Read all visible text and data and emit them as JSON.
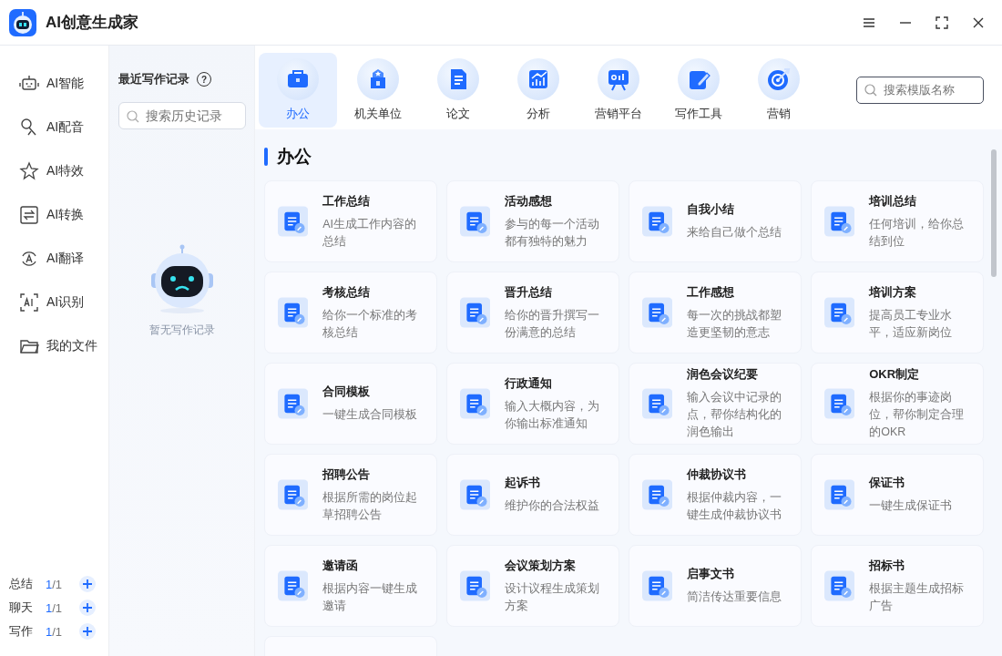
{
  "window": {
    "title": "AI创意生成家"
  },
  "nav": {
    "items": [
      {
        "label": "AI智能",
        "selected": false
      },
      {
        "label": "AI配音",
        "selected": false
      },
      {
        "label": "AI特效",
        "selected": false
      },
      {
        "label": "AI转换",
        "selected": false
      },
      {
        "label": "AI翻译",
        "selected": false
      },
      {
        "label": "AI识别",
        "selected": false
      },
      {
        "label": "我的文件",
        "selected": false
      }
    ],
    "quotas": [
      {
        "label": "总结",
        "used": "1",
        "total": "/1"
      },
      {
        "label": "聊天",
        "used": "1",
        "total": "/1"
      },
      {
        "label": "写作",
        "used": "1",
        "total": "/1"
      }
    ]
  },
  "history": {
    "title": "最近写作记录",
    "help": "?",
    "search": {
      "placeholder": "搜索历史记录"
    },
    "empty_text": "暂无写作记录"
  },
  "tabs": [
    {
      "label": "办公",
      "selected": true
    },
    {
      "label": "机关单位",
      "selected": false
    },
    {
      "label": "论文",
      "selected": false
    },
    {
      "label": "分析",
      "selected": false
    },
    {
      "label": "营销平台",
      "selected": false
    },
    {
      "label": "写作工具",
      "selected": false
    },
    {
      "label": "营销",
      "selected": false
    }
  ],
  "template_search": {
    "placeholder": "搜索模版名称"
  },
  "section": {
    "title": "办公"
  },
  "templates": [
    {
      "title": "工作总结",
      "description": "AI生成工作内容的总结"
    },
    {
      "title": "活动感想",
      "description": "参与的每一个活动都有独特的魅力"
    },
    {
      "title": "自我小结",
      "description": "来给自己做个总结"
    },
    {
      "title": "培训总结",
      "description": "任何培训，给你总结到位"
    },
    {
      "title": "考核总结",
      "description": "给你一个标准的考核总结"
    },
    {
      "title": "晋升总结",
      "description": "给你的晋升撰写一份满意的总结"
    },
    {
      "title": "工作感想",
      "description": "每一次的挑战都塑造更坚韧的意志"
    },
    {
      "title": "培训方案",
      "description": "提高员工专业水平，适应新岗位"
    },
    {
      "title": "合同模板",
      "description": "一键生成合同模板"
    },
    {
      "title": "行政通知",
      "description": "输入大概内容，为你输出标准通知"
    },
    {
      "title": "润色会议纪要",
      "description": "输入会议中记录的点，帮你结构化的润色输出"
    },
    {
      "title": "OKR制定",
      "description": "根据你的事迹岗位，帮你制定合理的OKR"
    },
    {
      "title": "招聘公告",
      "description": "根据所需的岗位起草招聘公告"
    },
    {
      "title": "起诉书",
      "description": "维护你的合法权益"
    },
    {
      "title": "仲裁协议书",
      "description": "根据仲裁内容，一键生成仲裁协议书"
    },
    {
      "title": "保证书",
      "description": "一键生成保证书"
    },
    {
      "title": "邀请函",
      "description": "根据内容一键生成邀请"
    },
    {
      "title": "会议策划方案",
      "description": "设计议程生成策划方案"
    },
    {
      "title": "启事文书",
      "description": "简洁传达重要信息"
    },
    {
      "title": "招标书",
      "description": "根据主题生成招标广告"
    }
  ]
}
